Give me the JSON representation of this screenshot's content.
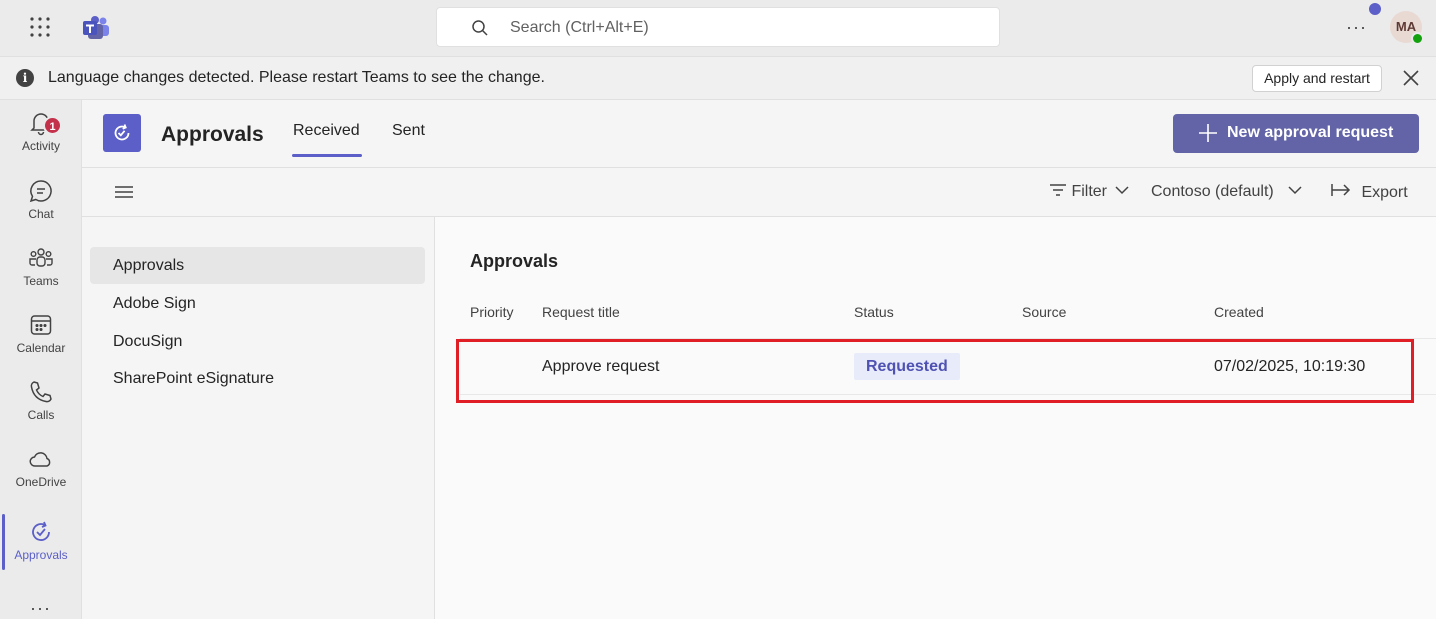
{
  "topbar": {
    "search_placeholder": "Search (Ctrl+Alt+E)",
    "more_label": "···",
    "avatar_initials": "MA",
    "icons": [
      "waffle-icon",
      "teams-logo-icon",
      "search-icon"
    ]
  },
  "banner": {
    "info_glyph": "i",
    "message": "Language changes detected. Please restart Teams to see the change.",
    "apply_label": "Apply and restart"
  },
  "rail": {
    "items": [
      {
        "label": "Activity",
        "icon": "bell-icon",
        "badge": "1"
      },
      {
        "label": "Chat",
        "icon": "chat-icon"
      },
      {
        "label": "Teams",
        "icon": "teams-icon"
      },
      {
        "label": "Calendar",
        "icon": "calendar-icon"
      },
      {
        "label": "Calls",
        "icon": "phone-icon"
      },
      {
        "label": "OneDrive",
        "icon": "cloud-icon"
      },
      {
        "label": "Approvals",
        "icon": "approvals-icon",
        "active": true
      }
    ],
    "more_label": "···"
  },
  "app": {
    "title": "Approvals",
    "tabs": [
      {
        "label": "Received",
        "selected": true
      },
      {
        "label": "Sent"
      }
    ],
    "new_button_label": "New approval request"
  },
  "toolbar": {
    "filter_label": "Filter",
    "org_label": "Contoso (default)",
    "export_label": "Export"
  },
  "sidenav": {
    "items": [
      {
        "label": "Approvals",
        "selected": true
      },
      {
        "label": "Adobe Sign"
      },
      {
        "label": "DocuSign"
      },
      {
        "label": "SharePoint eSignature"
      }
    ]
  },
  "main": {
    "title": "Approvals",
    "columns": [
      "Priority",
      "Request title",
      "Status",
      "Source",
      "Created"
    ],
    "rows": [
      {
        "priority": "",
        "title": "Approve request",
        "status": "Requested",
        "source": "",
        "created": "07/02/2025, 10:19:30"
      }
    ]
  },
  "colors": {
    "accent": "#5b5fc7",
    "button": "#6264a7",
    "highlight": "#e01e25",
    "badge": "#c4314b",
    "presence": "#13a10e"
  }
}
